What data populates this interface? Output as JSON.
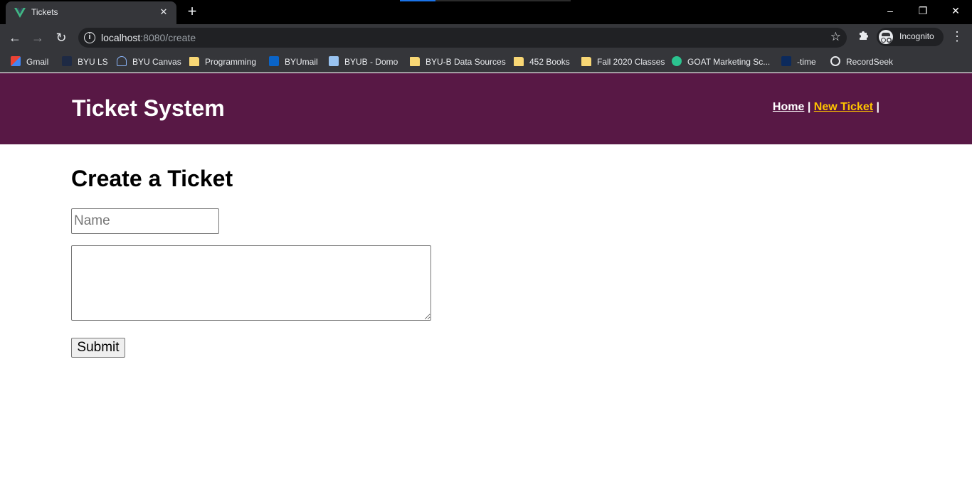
{
  "browser": {
    "tab_title": "Tickets",
    "tab_close_icon": "close-icon",
    "new_tab_icon": "plus-icon",
    "url_host": "localhost",
    "url_rest": ":8080/create",
    "profile_label": "Incognito",
    "bookmarks": [
      {
        "label": "Gmail",
        "icon": "gmail-icon"
      },
      {
        "label": "BYU LS",
        "icon": "byu-ls-icon"
      },
      {
        "label": "BYU Canvas",
        "icon": "canvas-icon"
      },
      {
        "label": "Programming",
        "icon": "folder-icon"
      },
      {
        "label": "BYUmail",
        "icon": "outlook-icon"
      },
      {
        "label": "BYUB - Domo",
        "icon": "domo-icon"
      },
      {
        "label": "BYU-B Data Sources",
        "icon": "folder-icon"
      },
      {
        "label": "452 Books",
        "icon": "folder-icon"
      },
      {
        "label": "Fall 2020 Classes",
        "icon": "folder-icon"
      },
      {
        "label": "GOAT Marketing Sc...",
        "icon": "goat-icon"
      },
      {
        "label": "-time",
        "icon": "byu-icon"
      },
      {
        "label": "RecordSeek",
        "icon": "globe-icon"
      }
    ],
    "colors": {
      "frame": "#000000",
      "toolbar": "#35363a",
      "omnibox": "#202124"
    }
  },
  "site": {
    "title": "Ticket System",
    "nav": {
      "home": "Home",
      "separator": "|",
      "new_ticket": "New Ticket"
    },
    "colors": {
      "header_bg": "#581845",
      "active_link": "#ffc300"
    }
  },
  "form": {
    "heading": "Create a Ticket",
    "name_placeholder": "Name",
    "name_value": "",
    "problem_value": "",
    "submit_label": "Submit"
  }
}
